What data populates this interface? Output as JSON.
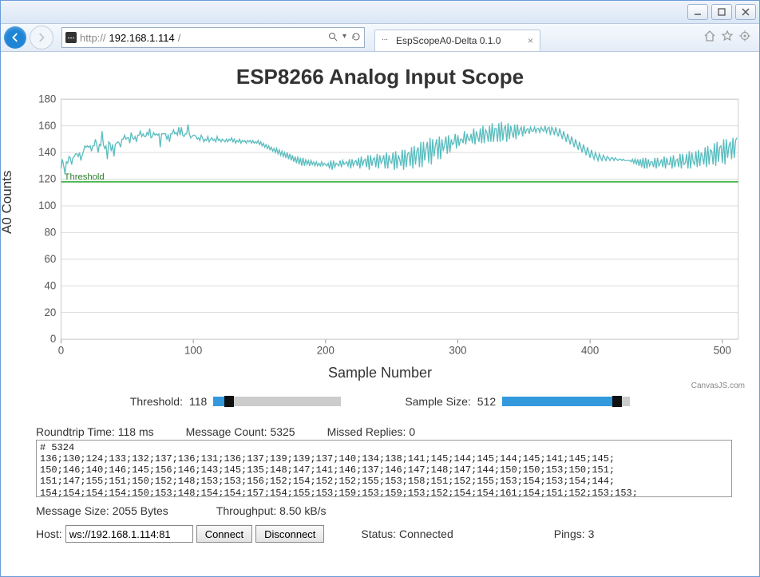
{
  "browser": {
    "url_prefix": "http://",
    "url_host": "192.168.1.114",
    "url_suffix": "/",
    "tab_title": "EspScopeA0-Delta 0.1.0"
  },
  "page": {
    "title": "ESP8266 Analog Input Scope",
    "ylabel": "A0 Counts",
    "xlabel": "Sample Number",
    "threshold_label": "Threshold",
    "canvasjs_label": "CanvasJS.com"
  },
  "controls": {
    "threshold_label": "Threshold:",
    "threshold_value": "118",
    "threshold_pct": 12,
    "sample_label": "Sample Size:",
    "sample_value": "512",
    "sample_pct": 90
  },
  "stats": {
    "roundtrip_label": "Roundtrip Time:",
    "roundtrip_value": "118",
    "roundtrip_unit": "ms",
    "msgcount_label": "Message Count:",
    "msgcount_value": "5325",
    "missed_label": "Missed Replies:",
    "missed_value": "0",
    "msgsize_label": "Message Size:",
    "msgsize_value": "2055",
    "msgsize_unit": "Bytes",
    "throughput_label": "Throughput:",
    "throughput_value": "8.50",
    "throughput_unit": "kB/s"
  },
  "log_text": "# 5324\n136;130;124;133;132;137;136;131;136;137;139;139;137;140;134;138;141;145;144;145;144;145;141;145;145;\n150;146;140;146;145;156;146;143;145;135;148;147;141;146;137;146;147;148;147;144;150;150;153;150;151;\n151;147;155;151;150;152;148;153;153;156;152;154;152;152;155;153;158;151;152;155;153;154;153;154;144;\n154;154;154;154;150;153;148;154;154;157;154;155;153;159;153;159;153;152;154;154;161;154;151;152;153;153;",
  "connection": {
    "host_label": "Host:",
    "host_value": "ws://192.168.1.114:81",
    "connect_label": "Connect",
    "disconnect_label": "Disconnect",
    "status_label": "Status:",
    "status_value": "Connected",
    "pings_label": "Pings:",
    "pings_value": "3"
  },
  "chart_data": {
    "type": "line",
    "title": "ESP8266 Analog Input Scope",
    "xlabel": "Sample Number",
    "ylabel": "A0 Counts",
    "xrange": [
      0,
      512
    ],
    "yrange": [
      0,
      180
    ],
    "x_ticks": [
      0,
      100,
      200,
      300,
      400,
      500
    ],
    "y_ticks": [
      0,
      20,
      40,
      60,
      80,
      100,
      120,
      140,
      160,
      180
    ],
    "threshold_line": 118,
    "series": [
      {
        "name": "A0",
        "color": "#5bbdbf",
        "values": [
          128,
          135,
          130,
          124,
          133,
          132,
          137,
          136,
          131,
          136,
          137,
          139,
          139,
          137,
          140,
          134,
          138,
          141,
          145,
          144,
          145,
          144,
          145,
          141,
          145,
          145,
          150,
          146,
          140,
          146,
          145,
          156,
          146,
          143,
          145,
          135,
          148,
          147,
          141,
          146,
          137,
          146,
          147,
          148,
          147,
          144,
          150,
          150,
          153,
          150,
          151,
          151,
          147,
          155,
          151,
          150,
          152,
          148,
          153,
          153,
          156,
          152,
          154,
          152,
          152,
          155,
          153,
          158,
          151,
          152,
          155,
          153,
          154,
          153,
          154,
          144,
          154,
          154,
          154,
          154,
          150,
          153,
          148,
          154,
          154,
          157,
          154,
          155,
          153,
          159,
          153,
          159,
          153,
          152,
          154,
          154,
          161,
          154,
          151,
          152,
          153,
          153,
          152,
          150,
          151,
          149,
          153,
          151,
          148,
          150,
          149,
          152,
          148,
          150,
          151,
          149,
          150,
          148,
          152,
          149,
          150,
          148,
          150,
          149,
          148,
          150,
          148,
          150,
          149,
          151,
          148,
          150,
          147,
          149,
          148,
          150,
          147,
          149,
          148,
          149,
          147,
          149,
          148,
          149,
          147,
          149,
          147,
          148,
          147,
          149,
          146,
          148,
          145,
          147,
          144,
          146,
          143,
          145,
          142,
          144,
          141,
          143,
          140,
          143,
          139,
          142,
          138,
          141,
          137,
          140,
          136,
          140,
          135,
          139,
          134,
          138,
          133,
          137,
          132,
          137,
          131,
          136,
          130,
          136,
          130,
          135,
          131,
          134,
          130,
          134,
          131,
          133,
          130,
          133,
          130,
          132,
          130,
          133,
          130,
          132,
          131,
          130,
          132,
          128,
          134,
          127,
          134,
          129,
          132,
          131,
          130,
          134,
          129,
          134,
          131,
          132,
          133,
          130,
          135,
          128,
          135,
          130,
          133,
          134,
          130,
          136,
          128,
          137,
          130,
          134,
          135,
          129,
          138,
          127,
          138,
          130,
          135,
          136,
          129,
          139,
          128,
          138,
          132,
          134,
          138,
          128,
          140,
          128,
          138,
          133,
          132,
          140,
          127,
          141,
          128,
          138,
          135,
          130,
          142,
          127,
          142,
          129,
          139,
          140,
          130,
          144,
          128,
          145,
          131,
          141,
          144,
          129,
          148,
          129,
          148,
          134,
          143,
          148,
          132,
          151,
          131,
          150,
          137,
          145,
          150,
          135,
          152,
          135,
          150,
          141,
          146,
          152,
          139,
          153,
          140,
          150,
          146,
          147,
          154,
          143,
          153,
          145,
          150,
          150,
          147,
          156,
          146,
          154,
          150,
          149,
          154,
          147,
          158,
          146,
          156,
          152,
          148,
          158,
          147,
          160,
          147,
          157,
          155,
          148,
          160,
          148,
          162,
          148,
          158,
          158,
          148,
          162,
          148,
          163,
          149,
          158,
          160,
          148,
          162,
          150,
          160,
          155,
          151,
          161,
          150,
          161,
          153,
          157,
          159,
          152,
          160,
          154,
          157,
          158,
          154,
          159,
          156,
          156,
          159,
          155,
          158,
          158,
          155,
          159,
          157,
          156,
          160,
          155,
          158,
          159,
          153,
          159,
          157,
          153,
          159,
          155,
          152,
          158,
          154,
          150,
          156,
          152,
          148,
          154,
          150,
          146,
          152,
          148,
          144,
          150,
          146,
          142,
          148,
          144,
          140,
          146,
          142,
          138,
          144,
          140,
          136,
          142,
          138,
          135,
          140,
          137,
          134,
          139,
          136,
          134,
          138,
          136,
          134,
          137,
          136,
          134,
          136,
          136,
          134,
          136,
          135,
          134,
          135,
          135,
          134,
          135,
          134,
          134,
          134,
          134,
          134,
          133,
          135,
          132,
          135,
          131,
          135,
          130,
          135,
          129,
          136,
          128,
          136,
          128,
          135,
          130,
          133,
          133,
          129,
          136,
          128,
          136,
          130,
          132,
          135,
          129,
          137,
          128,
          136,
          131,
          131,
          137,
          128,
          138,
          129,
          134,
          135,
          129,
          139,
          128,
          139,
          131,
          132,
          139,
          128,
          141,
          128,
          140,
          133,
          131,
          141,
          129,
          142,
          130,
          140,
          137,
          131,
          144,
          129,
          145,
          131,
          142,
          141,
          131,
          147,
          130,
          148,
          133,
          144,
          145,
          132,
          150,
          131,
          150,
          136,
          145,
          148,
          135,
          151,
          136,
          149,
          151
        ]
      }
    ]
  }
}
